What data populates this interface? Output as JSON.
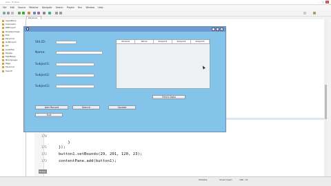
{
  "ide": {
    "title": "Java - Eclipse",
    "menu": [
      "File",
      "Edit",
      "Source",
      "Refactor",
      "Navigate",
      "Search",
      "Project",
      "Run",
      "Window",
      "Help"
    ],
    "editor_tab": "Personal",
    "explorer_items": [
      "AgeaMany",
      "Calculator",
      "DBProject",
      "DisplayImage",
      "Exit",
      "Personal",
      "GUIProject",
      "Jav",
      "JavaMap",
      "MyApp",
      "MyDBApp",
      "NLanguage",
      "Page",
      "Personal",
      "Search"
    ],
    "code_lines": [
      {
        "no": "170",
        "text": "            }"
      },
      {
        "no": "171",
        "text": "        });"
      },
      {
        "no": "172",
        "text": "        button1.setBounds(29, 201, 120, 23);"
      },
      {
        "no": "173",
        "text": "        contentPane.add(button1);"
      }
    ],
    "right_code": [
      ");",
      ""
    ],
    "status": {
      "writable": "Writable",
      "insert": "Smart Insert",
      "position": "186 : 23"
    },
    "bottom_tab": "Design"
  },
  "app": {
    "labels": {
      "std_id": "Std.ID:",
      "name": "Name:",
      "subject1": "Subject1:",
      "subject2": "Subject2:",
      "subject3": "Subject3:"
    },
    "table_headers": [
      "Student",
      "Name",
      "Subject1",
      "Subject2",
      "Subject3"
    ],
    "buttons": {
      "add_record": "Add Record",
      "search": "Search",
      "update": "Update",
      "exit": "Exit",
      "fetch_data": "Fetch Data"
    },
    "fields": {
      "std_id": "",
      "name": "",
      "subject1": "",
      "subject2": "",
      "subject3": ""
    }
  },
  "colors": {
    "app_background": "#85c4ea",
    "app_titlebar": "#6c9bd2"
  }
}
